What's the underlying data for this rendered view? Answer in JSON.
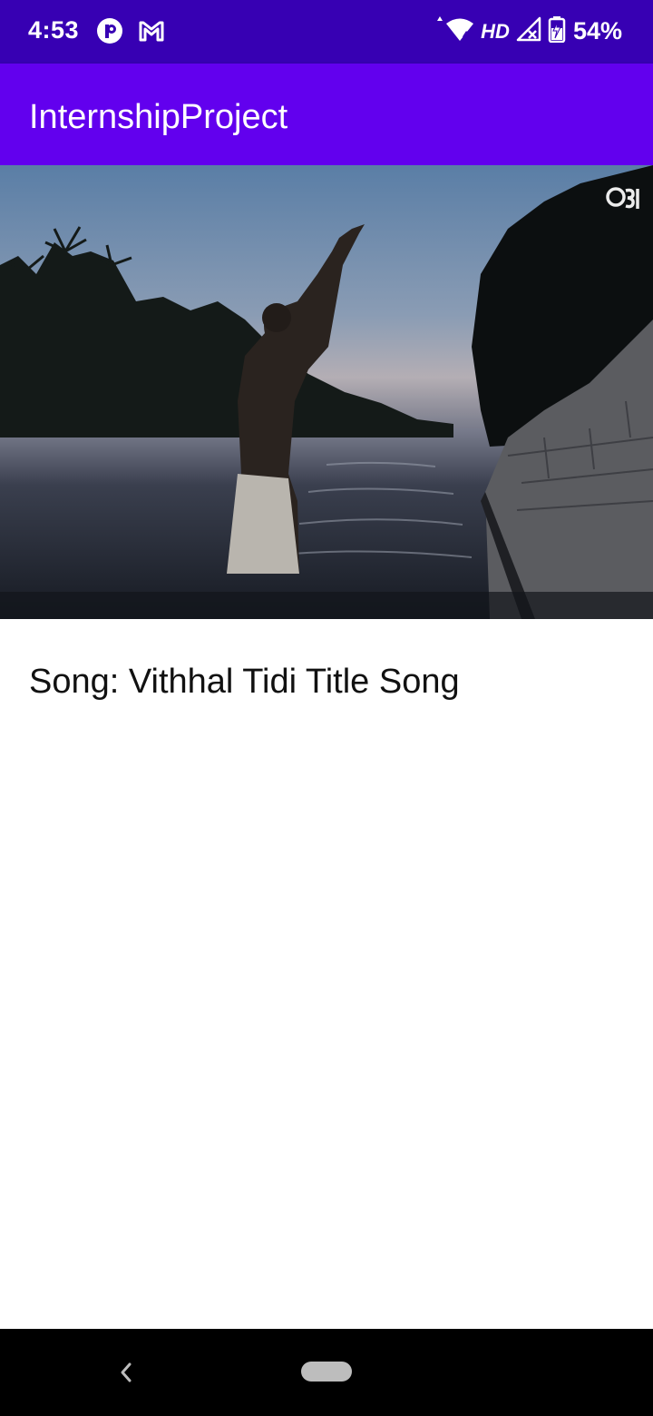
{
  "status_bar": {
    "time": "4:53",
    "left_icons": [
      "notification-app-icon",
      "gmail-icon"
    ],
    "right_icons": [
      "wifi-icon",
      "cell-signal-icon",
      "battery-icon"
    ],
    "network_label": "HD",
    "wifi_badge": "4",
    "battery_percent": "54%",
    "background": "#3700b3"
  },
  "app_bar": {
    "title": "InternshipProject",
    "background": "#6200ee"
  },
  "video": {
    "watermark": "Oȝl"
  },
  "content": {
    "song_title": "Song: Vithhal Tidi Title Song"
  },
  "nav_bar": {
    "icons": [
      "back-icon",
      "home-pill-icon"
    ]
  }
}
